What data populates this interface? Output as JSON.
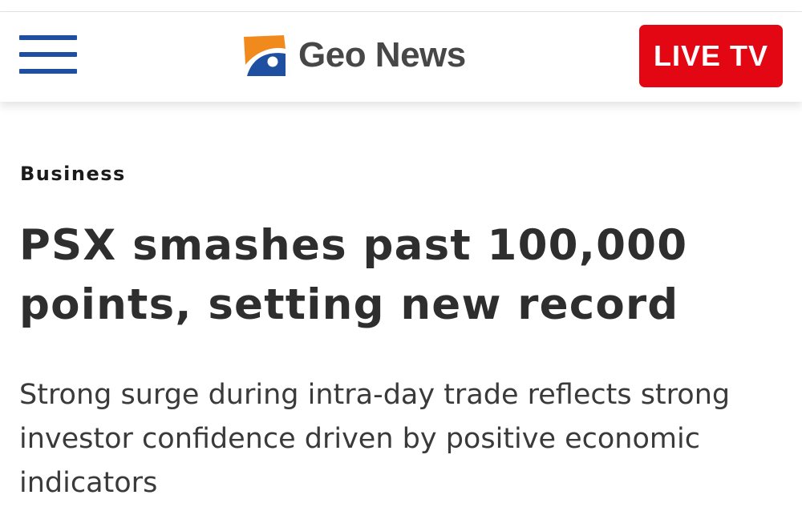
{
  "header": {
    "menu_icon": "hamburger-menu-icon",
    "logo": {
      "icon": "geo-news-logo-icon",
      "text": "Geo News",
      "colors": {
        "orange": "#f08a1c",
        "blue": "#1f4fa0",
        "text": "#474747"
      }
    },
    "live_button": {
      "label": "LIVE TV",
      "color": "#e30613"
    },
    "menu_color": "#1f4fa0"
  },
  "article": {
    "category": "Business",
    "headline": "PSX smashes past 100,000 points, setting new record",
    "summary": "Strong surge during intra-day trade reflects strong investor confidence driven by positive economic indicators"
  }
}
